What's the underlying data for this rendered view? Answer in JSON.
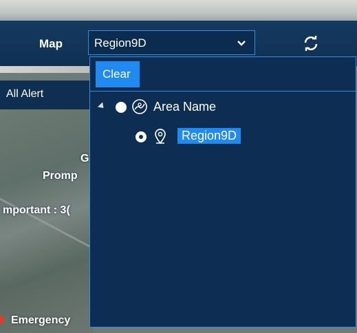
{
  "header": {
    "map_label": "Map",
    "map_select_value": "Region9D"
  },
  "background": {
    "tab_label": "All Alert",
    "line_g": "G",
    "line_prompt": "Promp",
    "line_important": "mportant : 3(",
    "line_emergency": "Emergency"
  },
  "dropdown": {
    "clear_label": "Clear",
    "tree": {
      "root_label": "Area Name",
      "child_label": "Region9D"
    }
  },
  "colors": {
    "panel": "#0e2d52",
    "accent": "#1f8af0",
    "border": "#2e8de6"
  },
  "icons": {
    "refresh": "refresh-icon",
    "chevron": "chevron-down-icon",
    "area": "area-globe-icon",
    "location": "location-pin-icon"
  }
}
